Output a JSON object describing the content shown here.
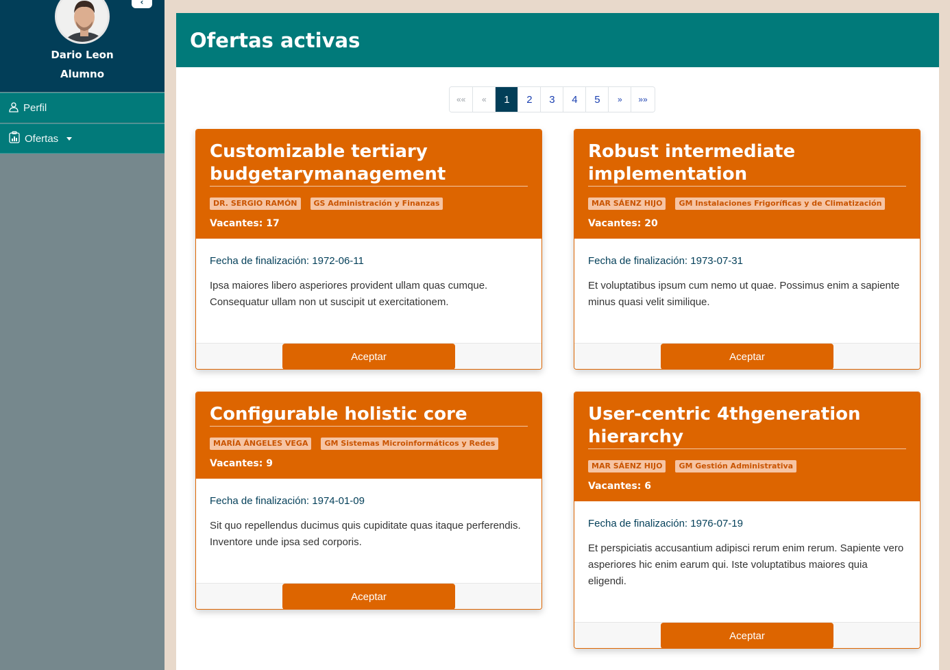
{
  "sidebar": {
    "user_name": "Dario Leon",
    "user_role": "Alumno",
    "toggle_label": "‹",
    "items": [
      {
        "label": "Perfil",
        "icon": "person-icon"
      },
      {
        "label": "Ofertas",
        "icon": "clipboard-chart-icon"
      }
    ]
  },
  "header": {
    "title": "Ofertas activas"
  },
  "pagination": {
    "first": "««",
    "prev": "«",
    "pages": [
      "1",
      "2",
      "3",
      "4",
      "5"
    ],
    "active_page": "1",
    "next": "»",
    "last": "»»"
  },
  "offers": [
    {
      "title": "Customizable tertiary budgetarymanagement",
      "tutor": "DR. SERGIO RAMÓN",
      "course": "GS Administración y Finanzas",
      "vacantes": "Vacantes: 17",
      "fecha": "Fecha de finalización: 1972-06-11",
      "description": "Ipsa maiores libero asperiores provident ullam quas cumque. Consequatur ullam non ut suscipit ut exercitationem.",
      "button": "Aceptar"
    },
    {
      "title": "Robust intermediate implementation",
      "tutor": "MAR SÁENZ HIJO",
      "course": "GM Instalaciones Frigoríficas y de Climatización",
      "vacantes": "Vacantes: 20",
      "fecha": "Fecha de finalización: 1973-07-31",
      "description": "Et voluptatibus ipsum cum nemo ut quae. Possimus enim a sapiente minus quasi velit similique.",
      "button": "Aceptar"
    },
    {
      "title": "Configurable holistic core",
      "tutor": "MARÍA ÁNGELES VEGA",
      "course": "GM Sistemas Microinformáticos y Redes",
      "vacantes": "Vacantes: 9",
      "fecha": "Fecha de finalización: 1974-01-09",
      "description": "Sit quo repellendus ducimus quis cupiditate quas itaque perferendis. Inventore unde ipsa sed corporis.",
      "button": "Aceptar"
    },
    {
      "title": "User-centric 4thgeneration hierarchy",
      "tutor": "MAR SÁENZ HIJO",
      "course": "GM Gestión Administrativa",
      "vacantes": "Vacantes: 6",
      "fecha": "Fecha de finalización: 1976-07-19",
      "description": "Et perspiciatis accusantium adipisci rerum enim rerum. Sapiente vero asperiores hic enim earum qui. Iste voluptatibus maiores quia eligendi.",
      "button": "Aceptar"
    }
  ],
  "colors": {
    "sidebar_head": "#023e58",
    "menu": "#027a7a",
    "accent": "#dd6500",
    "header": "#017a7a"
  }
}
